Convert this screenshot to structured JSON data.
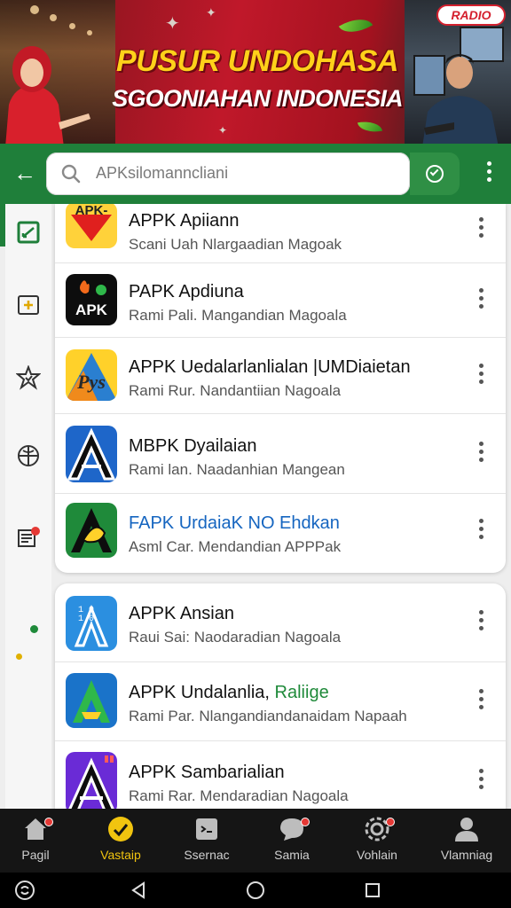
{
  "banner": {
    "headline": "PUSUR UNDOHASA",
    "subheadline": "SGOONIAHAN INDONESIA",
    "badge": "RADIO"
  },
  "topbar": {
    "search_placeholder": "APKsilomanncliani"
  },
  "sidebar": {
    "icons": [
      "edit-square-icon",
      "add-box-icon",
      "star-badge-icon",
      "globe-icon",
      "calendar-list-icon"
    ]
  },
  "apps_group_1": [
    {
      "title": "APPK Apiiann",
      "subtitle": "Scani Uah Nlargaadian Magoak",
      "icon": "apk-red-yellow-icon"
    },
    {
      "title": "PAPK Apdiuna",
      "subtitle": "Rami Pali. Mangandian Magoala",
      "icon": "apk-black-icon"
    },
    {
      "title": "APPK Uedalarlanlialan |UMDiaietan",
      "subtitle": "Rami Rur. Nandantiian Nagoala",
      "icon": "pys-yellow-icon"
    },
    {
      "title": "MBPK Dyailaian",
      "subtitle": "Rami lan. Naadanhian Mangean",
      "icon": "a-blue-icon"
    },
    {
      "title": "FAPK UrdaiaK NO Ehdkan",
      "subtitle": "Asml Car. Mendandian APPPak",
      "icon": "p-green-icon",
      "title_color": "#1565c0"
    }
  ],
  "apps_group_2": [
    {
      "title": "APPK Ansian",
      "subtitle": "Raui Sai: Naodaradian Nagoala",
      "icon": "a-lightblue-icon"
    },
    {
      "title": "APPK Undalanlia,",
      "title_highlight": "Raliige",
      "subtitle": "Rami Par. Nlangandiandanaidam Napaah",
      "icon": "a-green-blue-icon",
      "highlight_color": "#1f8a3a"
    },
    {
      "title": "APPK Sambarialian",
      "subtitle": "Rami Rar. Mendaradian Nagoala",
      "icon": "a-purple-icon"
    }
  ],
  "bottom_nav": [
    {
      "label": "Pagil",
      "icon": "home-icon",
      "badge": true
    },
    {
      "label": "Vastaip",
      "icon": "check-circle-icon",
      "active": true
    },
    {
      "label": "Ssernac",
      "icon": "terminal-icon"
    },
    {
      "label": "Samia",
      "icon": "chat-icon",
      "badge": true
    },
    {
      "label": "Vohlain",
      "icon": "settings-icon",
      "badge": true
    },
    {
      "label": "Vlamniag",
      "icon": "person-icon"
    }
  ],
  "colors": {
    "brand_green": "#1f7f3a",
    "active_yellow": "#f1c40f",
    "banner_red": "#c0182a"
  }
}
